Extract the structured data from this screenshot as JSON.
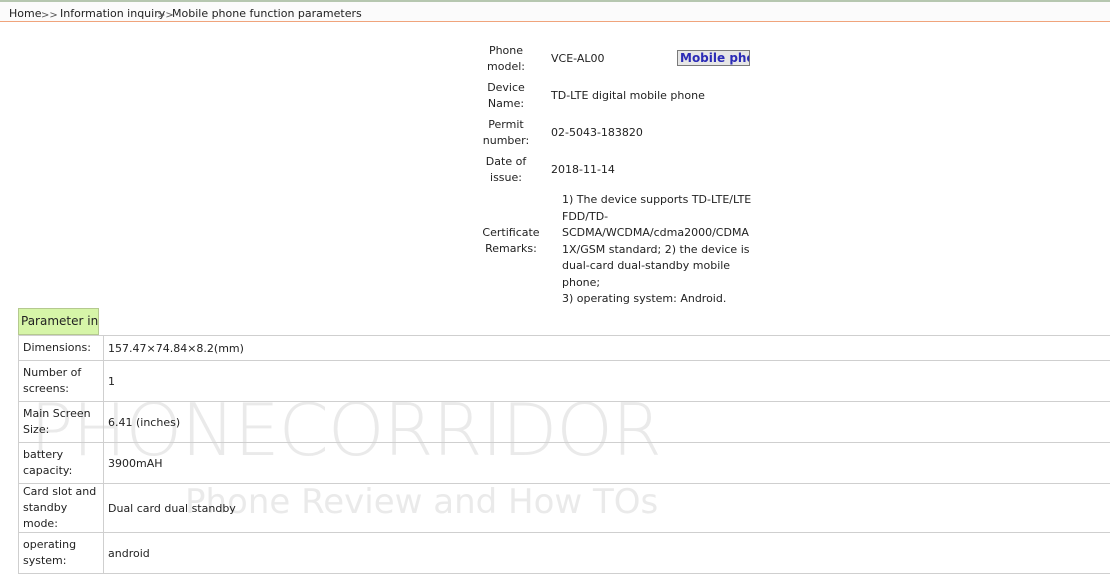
{
  "breadcrumb": {
    "home": "Home",
    "sep1": ">>",
    "info": "Information inquiry",
    "sep2": ">>",
    "current": "Mobile phone function parameters"
  },
  "certificate": {
    "model_label_1": "Phone",
    "model_label_2": "model:",
    "model_value": "VCE-AL00",
    "mobile_button": "Mobile phon",
    "device_label_1": "Device",
    "device_label_2": "Name:",
    "device_value": "TD-LTE digital mobile phone",
    "permit_label_1": "Permit",
    "permit_label_2": "number:",
    "permit_value": "02-5043-183820",
    "date_label_1": "Date of",
    "date_label_2": "issue:",
    "date_value": "2018-11-14",
    "remarks_label_1": "Certificate",
    "remarks_label_2": "Remarks:",
    "remarks_lines": [
      "1) The device supports TD-LTE/LTE",
      "FDD/TD-",
      "SCDMA/WCDMA/cdma2000/CDMA",
      "1X/GSM standard; 2) the device is",
      "dual-card dual-standby mobile phone;",
      "3) operating system: Android."
    ]
  },
  "parameters": {
    "header": "Parameter info",
    "rows": [
      {
        "key": "Dimensions:",
        "value": "157.47×74.84×8.2(mm)"
      },
      {
        "key": "Number of screens:",
        "value": "1"
      },
      {
        "key": "Main Screen Size:",
        "value": "6.41 (inches)"
      },
      {
        "key": "battery capacity:",
        "value": "3900mAH"
      },
      {
        "key": "Card slot and standby mode:",
        "value": "Dual card dual standby"
      },
      {
        "key": "operating system:",
        "value": "android"
      }
    ]
  },
  "watermark": {
    "line1": "PHONECORRIDOR",
    "line2": "Phone Review and How TOs"
  }
}
